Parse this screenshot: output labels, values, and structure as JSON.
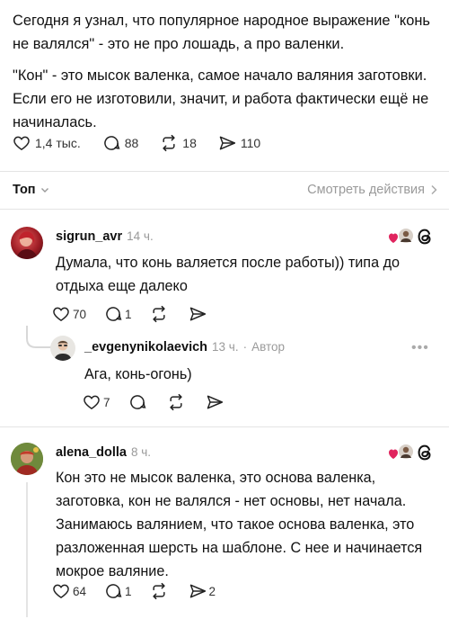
{
  "post": {
    "paragraph1": "Сегодня я узнал, что популярное народное выражение \"конь не валялся\" - это не про лошадь, а про валенки.",
    "paragraph2": "\"Кон\" - это мысок валенка, самое начало валяния заготовки. Если его не изготовили, значит, и работа фактически ещё не начиналась.",
    "likes": "1,4 тыс.",
    "comments": "88",
    "reposts": "18",
    "shares": "110"
  },
  "sortbar": {
    "sort_label": "Топ",
    "actions_label": "Смотреть действия"
  },
  "comments": [
    {
      "username": "sigrun_avr",
      "time": "14 ч.",
      "text": "Думала, что конь валяется после работы)) типа до отдыха еще далеко",
      "likes": "70",
      "replies": "1",
      "reply": {
        "username": "_evgenynikolaevich",
        "time": "13 ч.",
        "separator": "·",
        "author_tag": "Автор",
        "more": "•••",
        "text": "Ага, конь-огонь)",
        "likes": "7"
      }
    },
    {
      "username": "alena_dolla",
      "time": "8 ч.",
      "text": "Кон это не мысок валенка, это основа валенка, заготовка, кон не валялся - нет основы, нет начала. Занимаюсь валянием, что такое основа валенка, это разложенная шерсть на шаблоне. С нее и начинается мокрое валяние.",
      "likes": "64",
      "replies": "1",
      "shares": "2"
    }
  ],
  "colors": {
    "heart_badge": "#e0245e",
    "muted": "#9a9a9a",
    "divider": "#e4e4e4"
  }
}
